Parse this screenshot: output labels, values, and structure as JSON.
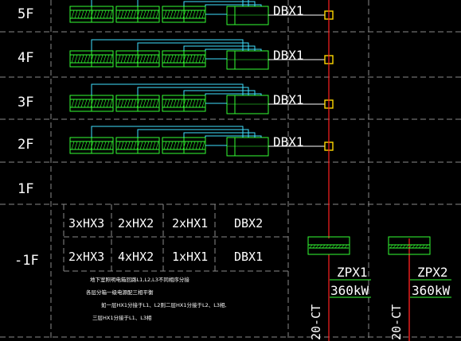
{
  "floors": [
    "5F",
    "4F",
    "3F",
    "2F",
    "1F",
    "-1F"
  ],
  "riser_floors": [
    {
      "floor": "5F",
      "box": "DBX1"
    },
    {
      "floor": "4F",
      "box": "DBX1"
    },
    {
      "floor": "3F",
      "box": "DBX1"
    },
    {
      "floor": "2F",
      "box": "DBX1"
    }
  ],
  "summary_table": {
    "row1": [
      "3xHX3",
      "2xHX2",
      "2xHX1",
      "DBX2"
    ],
    "row2": [
      "2xHX3",
      "4xHX2",
      "1xHX1",
      "DBX1"
    ]
  },
  "notes": [
    "地下室照明电箱回路L1,L2,L3不同相序分接",
    "各层分箱一级电源配三相平衡",
    "如一层HX1分接于L1、L2则二层HX1分接于L2、L3相,",
    "三层HX1分接于L1、L3相"
  ],
  "panels": [
    {
      "name": "ZPX1",
      "power": "360kW",
      "cable": "20-CT"
    },
    {
      "name": "ZPX2",
      "power": "360kW",
      "cable": "20-CT"
    }
  ],
  "colors": {
    "background": "#000000",
    "grid": "#8a8a8a",
    "green": "#33ff33",
    "cyan": "#40e0ff",
    "red": "#ff2020",
    "yellow": "#ffd700"
  }
}
